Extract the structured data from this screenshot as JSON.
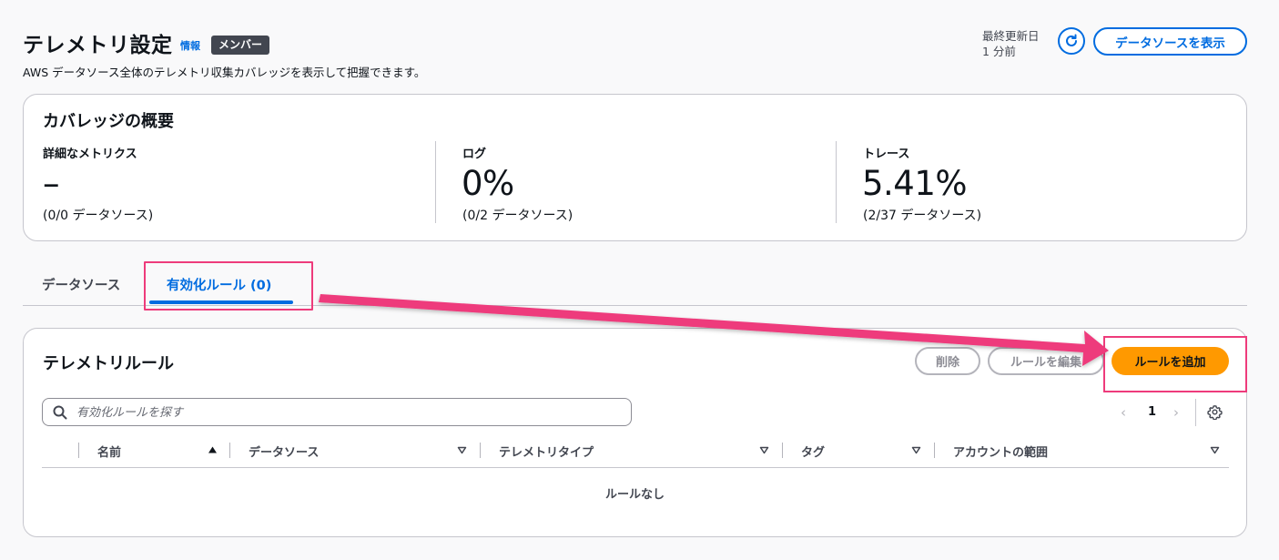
{
  "header": {
    "title": "テレメトリ設定",
    "info_link": "情報",
    "badge": "メンバー",
    "description": "AWS データソース全体のテレメトリ収集カバレッジを表示して把握できます。",
    "last_updated_label": "最終更新日",
    "last_updated_value": "1 分前",
    "view_datasources_button": "データソースを表示"
  },
  "coverage": {
    "title": "カバレッジの概要",
    "metrics": [
      {
        "label": "詳細なメトリクス",
        "value": "–",
        "sub": "(0/0 データソース)"
      },
      {
        "label": "ログ",
        "value": "0%",
        "sub": "(0/2 データソース)"
      },
      {
        "label": "トレース",
        "value": "5.41%",
        "sub": "(2/37 データソース)"
      }
    ]
  },
  "tabs": [
    {
      "label": "データソース",
      "active": false
    },
    {
      "label": "有効化ルール (0)",
      "active": true
    }
  ],
  "rules": {
    "title": "テレメトリルール",
    "delete_button": "削除",
    "edit_button": "ルールを編集",
    "add_button": "ルールを追加",
    "search_placeholder": "有効化ルールを探す",
    "page": "1",
    "columns": [
      "名前",
      "データソース",
      "テレメトリタイプ",
      "タグ",
      "アカウントの範囲"
    ],
    "empty_text": "ルールなし"
  },
  "colors": {
    "accent": "#006ce0",
    "primary_button": "#ff9900",
    "highlight": "#ee3b7b"
  }
}
